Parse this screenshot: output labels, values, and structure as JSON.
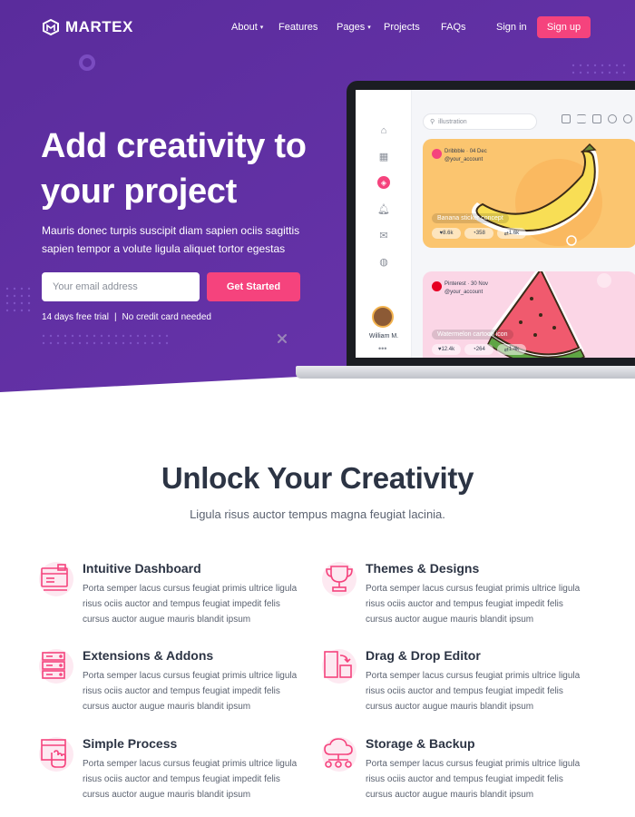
{
  "brand": {
    "name": "MARTEX",
    "accent": "#f5437d",
    "hero_bg": "#5e2ea0"
  },
  "nav": {
    "links": [
      {
        "label": "About",
        "dropdown": true
      },
      {
        "label": "Features",
        "dropdown": false
      },
      {
        "label": "Pages",
        "dropdown": true
      },
      {
        "label": "Projects",
        "dropdown": false
      },
      {
        "label": "FAQs",
        "dropdown": false
      }
    ],
    "signin": "Sign in",
    "signup": "Sign up"
  },
  "hero": {
    "title": "Add creativity to your project",
    "subtitle": "Mauris donec turpis suscipit diam sapien ociis sagittis sapien tempor a volute ligula aliquet tortor egestas",
    "email_placeholder": "Your email address",
    "cta": "Get Started",
    "note_left": "14 days free trial",
    "note_sep": "|",
    "note_right": "No credit card needed"
  },
  "app_preview": {
    "search": "illustration",
    "user_name": "William M.",
    "cards": [
      {
        "source": "Dribbble",
        "date": "04 Dec",
        "handle": "@your_account",
        "caption": "Banana sticker concept",
        "likes": "8.6k",
        "comments": "358",
        "shares": "1.6k"
      },
      {
        "source": "Pinterest",
        "date": "30 Nov",
        "handle": "@your_account",
        "caption": "Watermelon cartoon icon",
        "likes": "12.4k",
        "comments": "264",
        "shares": "1.4k"
      }
    ]
  },
  "features_section": {
    "title": "Unlock Your Creativity",
    "subtitle": "Ligula risus auctor tempus magna feugiat lacinia.",
    "items": [
      {
        "title": "Intuitive Dashboard",
        "icon": "dashboard-icon",
        "text": "Porta semper lacus cursus feugiat primis ultrice ligula risus ociis auctor and tempus feugiat impedit felis cursus auctor augue mauris blandit ipsum"
      },
      {
        "title": "Themes & Designs",
        "icon": "trophy-icon",
        "text": "Porta semper lacus cursus feugiat primis ultrice ligula risus ociis auctor and tempus feugiat impedit felis cursus auctor augue mauris blandit ipsum"
      },
      {
        "title": "Extensions & Addons",
        "icon": "server-icon",
        "text": "Porta semper lacus cursus feugiat primis ultrice ligula risus ociis auctor and tempus feugiat impedit felis cursus auctor augue mauris blandit ipsum"
      },
      {
        "title": "Drag & Drop Editor",
        "icon": "drag-drop-icon",
        "text": "Porta semper lacus cursus feugiat primis ultrice ligula risus ociis auctor and tempus feugiat impedit felis cursus auctor augue mauris blandit ipsum"
      },
      {
        "title": "Simple Process",
        "icon": "click-process-icon",
        "text": "Porta semper lacus cursus feugiat primis ultrice ligula risus ociis auctor and tempus feugiat impedit felis cursus auctor augue mauris blandit ipsum"
      },
      {
        "title": "Storage & Backup",
        "icon": "cloud-storage-icon",
        "text": "Porta semper lacus cursus feugiat primis ultrice ligula risus ociis auctor and tempus feugiat impedit felis cursus auctor augue mauris blandit ipsum"
      }
    ]
  }
}
